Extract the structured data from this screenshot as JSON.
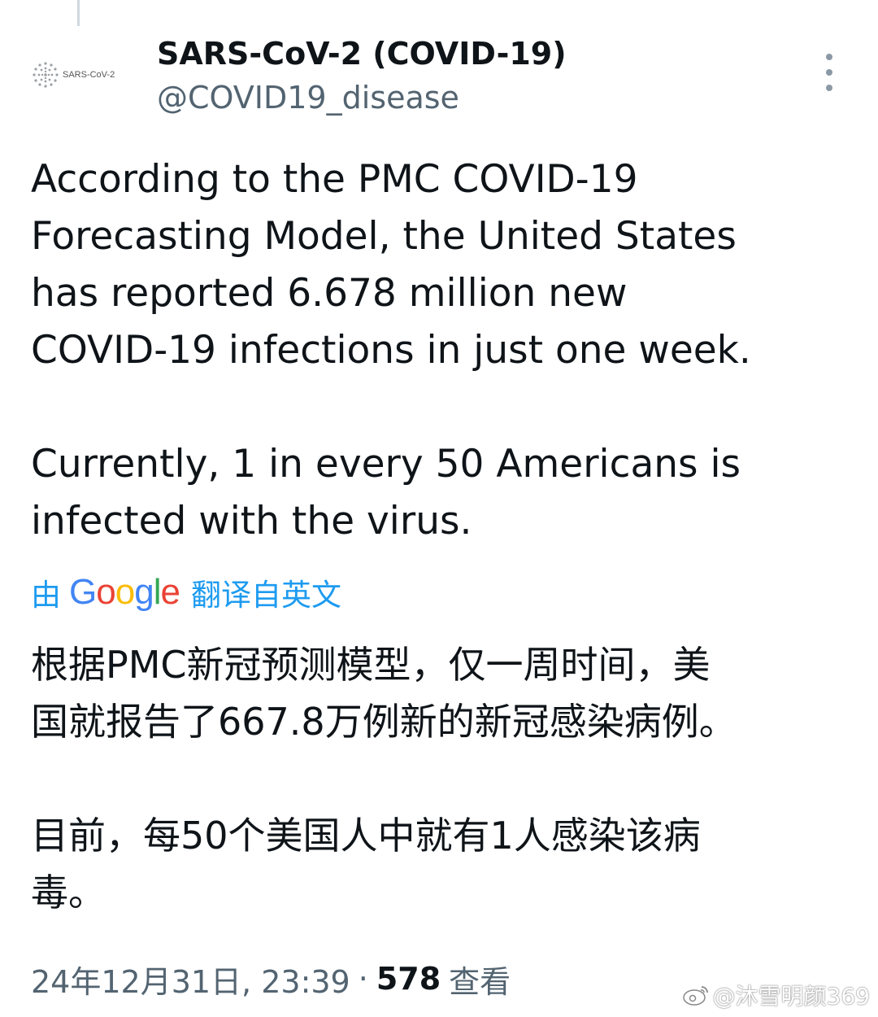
{
  "tweet": {
    "display_name": "SARS-CoV-2 (COVID-19)",
    "handle": "@COVID19_disease",
    "avatar_text": "SARS-CoV-2",
    "text_lines": [
      "According to the PMC COVID-19",
      "Forecasting Model, the United States",
      "has reported 6.678 million new",
      "COVID-19 infections in just one week."
    ],
    "text_lines_2": [
      "Currently, 1 in every 50 Americans is",
      "infected with the virus."
    ],
    "translate": {
      "prefix": "由",
      "google": [
        "G",
        "o",
        "o",
        "g",
        "l",
        "e"
      ],
      "suffix": "翻译自英文"
    },
    "translated_lines": [
      "根据PMC新冠预测模型，仅一周时间，美",
      "国就报告了667.8万例新的新冠感染病例。"
    ],
    "translated_lines_2": [
      "目前，每50个美国人中就有1人感染该病",
      "毒。"
    ],
    "timestamp": "24年12月31日, 23:39",
    "separator": "·",
    "view_count": "578",
    "view_label": "查看"
  },
  "watermark": {
    "text": "@沐雪明颜369",
    "icon": "weibo-icon"
  },
  "colors": {
    "text": "#0f1419",
    "secondary": "#536471",
    "accent": "#1d9bf0"
  }
}
